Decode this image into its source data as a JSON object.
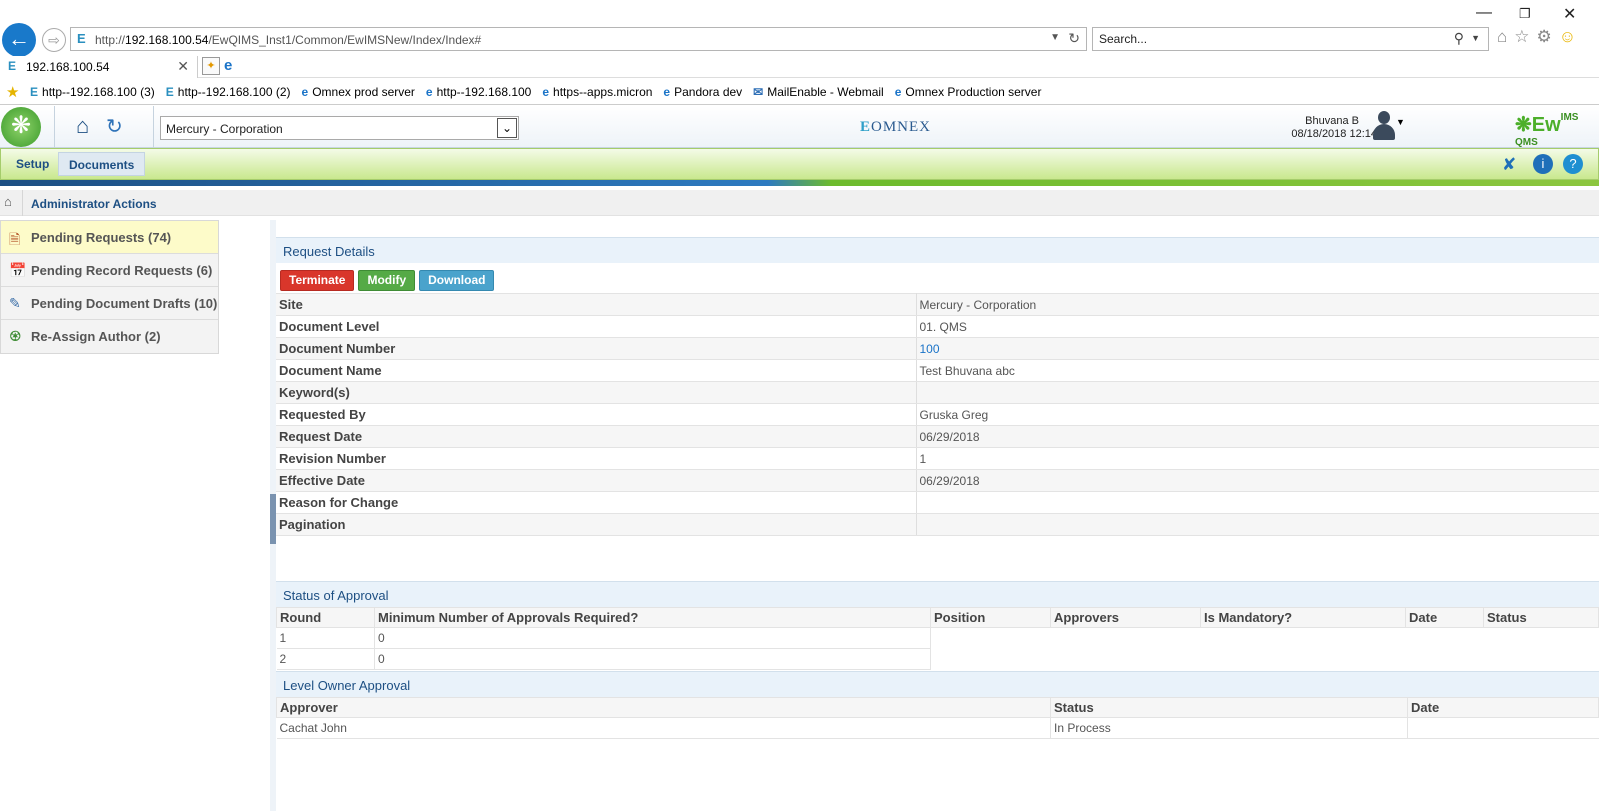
{
  "browser": {
    "url_prefix": "http://",
    "url_host": "192.168.100.54",
    "url_path": "/EwQIMS_Inst1/Common/EwIMSNew/Index/Index#",
    "search_placeholder": "Search...",
    "tab_title": "192.168.100.54",
    "favorites": [
      {
        "label": "http--192.168.100 (3)",
        "icon": "ewims-favicon"
      },
      {
        "label": "http--192.168.100 (2)",
        "icon": "ewims-favicon"
      },
      {
        "label": "Omnex prod server",
        "icon": "ie-page-icon"
      },
      {
        "label": "http--192.168.100",
        "icon": "ie-page-icon"
      },
      {
        "label": "https--apps.micron",
        "icon": "ie-page-icon"
      },
      {
        "label": "Pandora dev",
        "icon": "ie-page-icon"
      },
      {
        "label": "MailEnable - Webmail",
        "icon": "mail-icon"
      },
      {
        "label": "Omnex Production server",
        "icon": "ie-page-icon"
      }
    ]
  },
  "header": {
    "site_select": "Mercury - Corporation",
    "brand": "OMNEX",
    "user_name": "Bhuvana B",
    "user_datetime": "08/18/2018 12:14",
    "app_logo_main": "Ew",
    "app_logo_sup": "IMS",
    "app_logo_sub": "QMS"
  },
  "menu": {
    "setup": "Setup",
    "documents": "Documents"
  },
  "breadcrumb": {
    "title": "Administrator Actions"
  },
  "sidebar": {
    "items": [
      {
        "label": "Pending Requests (74)",
        "icon": "pending-requests-icon"
      },
      {
        "label": "Pending Record Requests (6)",
        "icon": "record-requests-icon"
      },
      {
        "label": "Pending Document Drafts (10)",
        "icon": "document-drafts-icon"
      },
      {
        "label": "Re-Assign Author (2)",
        "icon": "reassign-author-icon"
      }
    ]
  },
  "request_details": {
    "title": "Request Details",
    "buttons": {
      "terminate": "Terminate",
      "modify": "Modify",
      "download": "Download"
    },
    "rows": [
      {
        "label": "Site",
        "value": "Mercury - Corporation"
      },
      {
        "label": "Document Level",
        "value": "01. QMS"
      },
      {
        "label": "Document Number",
        "value": "100"
      },
      {
        "label": "Document Name",
        "value": "Test Bhuvana abc"
      },
      {
        "label": "Keyword(s)",
        "value": ""
      },
      {
        "label": "Requested By",
        "value": "Gruska Greg"
      },
      {
        "label": "Request Date",
        "value": "06/29/2018"
      },
      {
        "label": "Revision Number",
        "value": "1"
      },
      {
        "label": "Effective Date",
        "value": "06/29/2018"
      },
      {
        "label": "Reason for Change",
        "value": ""
      },
      {
        "label": "Pagination",
        "value": ""
      }
    ]
  },
  "approval_status": {
    "title": "Status of Approval",
    "columns": [
      "Round",
      "Minimum Number of Approvals Required?",
      "Position",
      "Approvers",
      "Is Mandatory?",
      "Date",
      "Status"
    ],
    "rows": [
      [
        "1",
        "0"
      ],
      [
        "2",
        "0"
      ]
    ]
  },
  "level_owner": {
    "title": "Level Owner Approval",
    "columns": [
      "Approver",
      "Status",
      "Date"
    ],
    "rows": [
      [
        "Cachat John",
        "In Process",
        ""
      ]
    ]
  }
}
